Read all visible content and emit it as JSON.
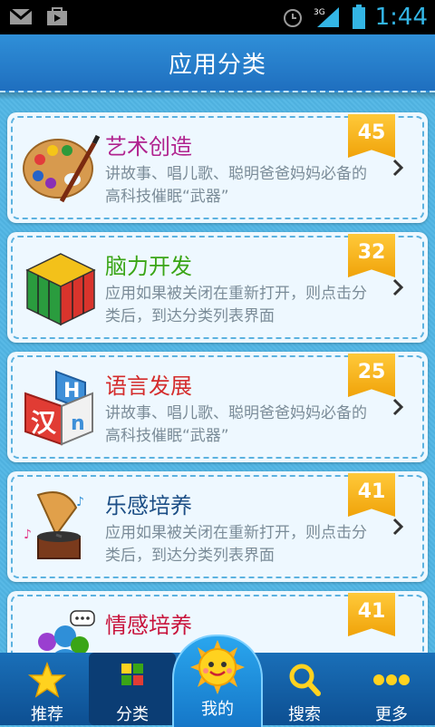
{
  "status_bar": {
    "time": "1:44",
    "network": "3G",
    "icons": [
      "gmail-icon",
      "shopping-bag-icon",
      "alarm-icon",
      "signal-icon",
      "battery-icon"
    ]
  },
  "header": {
    "title": "应用分类"
  },
  "categories": [
    {
      "name": "艺术创造",
      "name_color": "#b0238f",
      "count": "45",
      "description": "讲故事、唱儿歌、聪明爸爸妈妈必备的高科技催眠“武器”",
      "icon": "paint-palette-icon"
    },
    {
      "name": "脑力开发",
      "name_color": "#3aa516",
      "count": "32",
      "description": "应用如果被关闭在重新打开，则点击分类后，到达分类列表界面",
      "icon": "rubiks-cube-icon"
    },
    {
      "name": "语言发展",
      "name_color": "#d42c2c",
      "count": "25",
      "description": "讲故事、唱儿歌、聪明爸爸妈妈必备的高科技催眠“武器”",
      "icon": "letter-blocks-icon"
    },
    {
      "name": "乐感培养",
      "name_color": "#1d4f86",
      "count": "41",
      "description": "应用如果被关闭在重新打开，则点击分类后，到达分类列表界面",
      "icon": "gramophone-icon"
    },
    {
      "name": "情感培养",
      "name_color": "#c8143c",
      "count": "41",
      "description": "",
      "icon": "people-chat-icon"
    }
  ],
  "nav": {
    "items": [
      {
        "label": "推荐",
        "icon": "star-icon"
      },
      {
        "label": "分类",
        "icon": "category-grid-icon"
      },
      {
        "label": "我的",
        "icon": "sun-face-icon"
      },
      {
        "label": "搜索",
        "icon": "magnifier-icon"
      },
      {
        "label": "更多",
        "icon": "more-dots-icon"
      }
    ],
    "active_index": 1
  },
  "colors": {
    "status_accent": "#33b5e5",
    "header": "#2a85d2",
    "badge": "#f5b01f",
    "nav_bg": "#0d4f92"
  }
}
